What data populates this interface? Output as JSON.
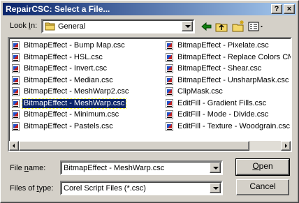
{
  "window": {
    "title": "RepairCSC: Select a File...",
    "help_glyph": "?",
    "close_glyph": "×"
  },
  "lookin": {
    "label_u": "I",
    "label_prefix": "Look ",
    "label_suffix": "n:",
    "folder": "General"
  },
  "icons": {
    "folder": "folder-icon",
    "back": "back-arrow-icon",
    "up": "up-folder-icon",
    "newfolder": "new-folder-icon",
    "view": "view-menu-icon",
    "file": "corel-script-file-icon"
  },
  "files": [
    "BitmapEffect - Bump Map.csc",
    "BitmapEffect - HSL.csc",
    "BitmapEffect - Invert.csc",
    "BitmapEffect - Median.csc",
    "BitmapEffect - MeshWarp2.csc",
    "BitmapEffect - MeshWarp.csc",
    "BitmapEffect - Minimum.csc",
    "BitmapEffect - Pastels.csc",
    "BitmapEffect - Pixelate.csc",
    "BitmapEffect - Replace Colors CMYK.csc",
    "BitmapEffect - Shear.csc",
    "BitmapEffect - UnsharpMask.csc",
    "ClipMask.csc",
    "EditFill - Gradient Fills.csc",
    "EditFill - Mode - Divide.csc",
    "EditFill - Texture - Woodgrain.csc"
  ],
  "selected_file": "BitmapEffect - MeshWarp.csc",
  "filename": {
    "label_prefix": "File ",
    "label_u": "n",
    "label_suffix": "ame:",
    "value": "BitmapEffect - MeshWarp.csc"
  },
  "filetype": {
    "label_prefix": "Files of ",
    "label_u": "t",
    "label_suffix": "ype:",
    "value": "Corel Script Files (*.csc)"
  },
  "buttons": {
    "open_u": "O",
    "open_rest": "pen",
    "cancel": "Cancel"
  },
  "colors": {
    "title_start": "#0a246a",
    "title_end": "#a6caf0",
    "selection": "#0a246a",
    "face": "#d4d0c8"
  }
}
